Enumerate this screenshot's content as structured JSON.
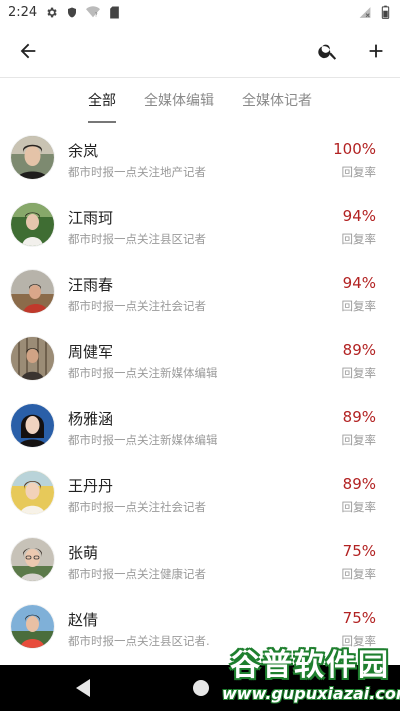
{
  "status_bar": {
    "time": "2:24"
  },
  "tabs": [
    {
      "label": "全部",
      "active": true
    },
    {
      "label": "全媒体编辑",
      "active": false
    },
    {
      "label": "全媒体记者",
      "active": false
    }
  ],
  "rate_color": "#b22222",
  "people": [
    {
      "name": "余岚",
      "desc": "都市时报一点关注地产记者",
      "rate": "100%",
      "rate_label": "回复率"
    },
    {
      "name": "江雨珂",
      "desc": "都市时报一点关注县区记者",
      "rate": "94%",
      "rate_label": "回复率"
    },
    {
      "name": "汪雨春",
      "desc": "都市时报一点关注社会记者",
      "rate": "94%",
      "rate_label": "回复率"
    },
    {
      "name": "周健军",
      "desc": "都市时报一点关注新媒体编辑",
      "rate": "89%",
      "rate_label": "回复率"
    },
    {
      "name": "杨雅涵",
      "desc": "都市时报一点关注新媒体编辑",
      "rate": "89%",
      "rate_label": "回复率"
    },
    {
      "name": "王丹丹",
      "desc": "都市时报一点关注社会记者",
      "rate": "89%",
      "rate_label": "回复率"
    },
    {
      "name": "张萌",
      "desc": "都市时报一点关注健康记者",
      "rate": "75%",
      "rate_label": "回复率"
    },
    {
      "name": "赵倩",
      "desc": "都市时报一点关注县区记者.",
      "rate": "75%",
      "rate_label": "回复率"
    }
  ],
  "watermark": {
    "title": "谷普软件园",
    "url": "www.gupuxiazai.com"
  }
}
